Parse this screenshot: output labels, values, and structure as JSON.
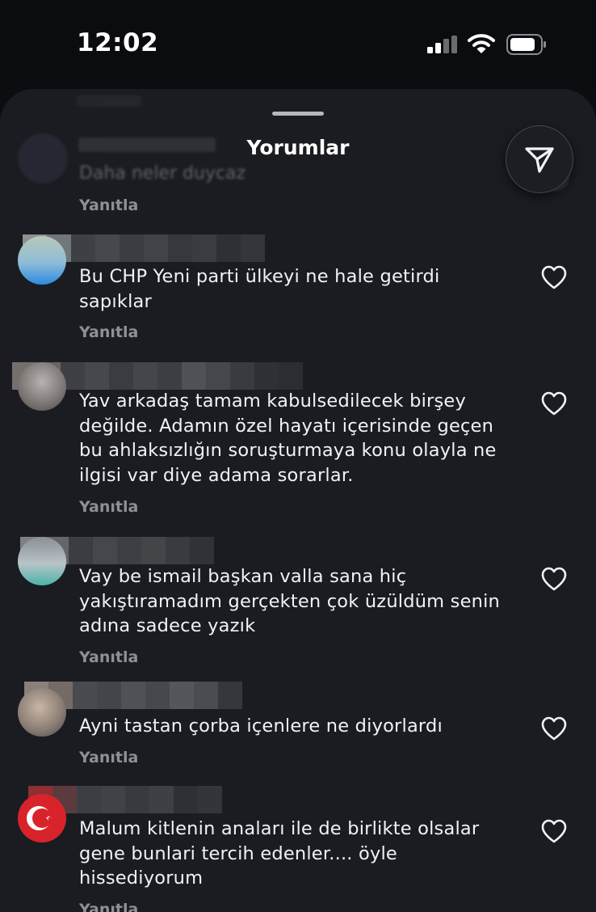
{
  "status_bar": {
    "time": "12:02"
  },
  "sheet": {
    "title": "Yorumlar"
  },
  "faded_comment": {
    "text": "Daha neler duycaz",
    "reply_label": "Yanıtla"
  },
  "comments": [
    {
      "text": "Bu CHP Yeni parti ülkeyi ne hale getirdi sapıklar",
      "reply_label": "Yanıtla"
    },
    {
      "text": "Yav arkadaş tamam kabulsedilecek birşey değilde. Adamın özel hayatı içerisinde geçen bu ahlaksızlığın soruşturmaya konu olayla ne ilgisi var diye adama sorarlar.",
      "reply_label": "Yanıtla"
    },
    {
      "text": "Vay be ismail başkan valla sana hiç yakıştıramadım gerçekten çok üzüldüm senin adına sadece yazık",
      "reply_label": "Yanıtla"
    },
    {
      "text": "Ayni tastan çorba içenlere ne diyorlardı",
      "reply_label": "Yanıtla"
    },
    {
      "text": "Malum kitlenin anaları ile de birlikte olsalar gene bunlari tercih edenler.... öyle hissediyorum",
      "reply_label": "Yanıtla"
    }
  ],
  "icons": {
    "send": "send-paper-plane-icon",
    "like": "heart-outline-icon",
    "signal": "cellular-signal-icon",
    "wifi": "wifi-icon",
    "battery": "battery-icon"
  },
  "colors": {
    "background": "#0c0d10",
    "sheet": "#1b1c21",
    "muted": "#8e9097"
  }
}
